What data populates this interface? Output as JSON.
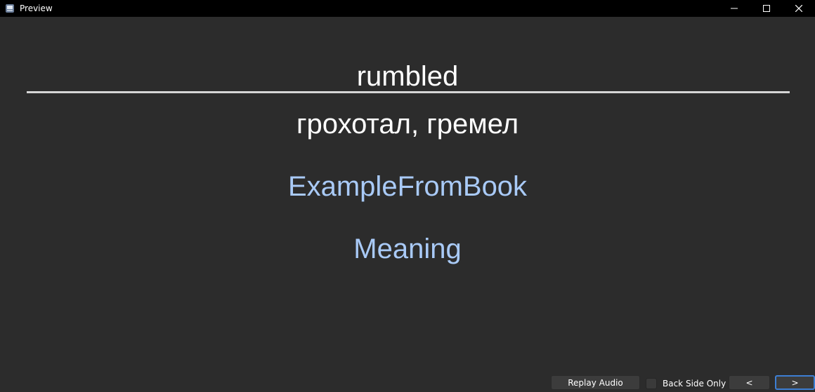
{
  "window": {
    "title": "Preview",
    "icon": "app-icon",
    "controls": [
      "minimize-icon",
      "maximize-icon",
      "close-icon"
    ]
  },
  "card": {
    "front": "rumbled",
    "translation": "грохотал, гремел",
    "example": "ExampleFromBook",
    "meaning": "Meaning"
  },
  "bottom_bar": {
    "replay_label": "Replay Audio",
    "back_side_only_label": "Back Side Only",
    "back_side_only_checked": false,
    "prev_label": "<",
    "next_label": ">"
  },
  "colors": {
    "background": "#2c2c2c",
    "field_link": "#a9caf7",
    "focus": "#3d7fd4"
  }
}
